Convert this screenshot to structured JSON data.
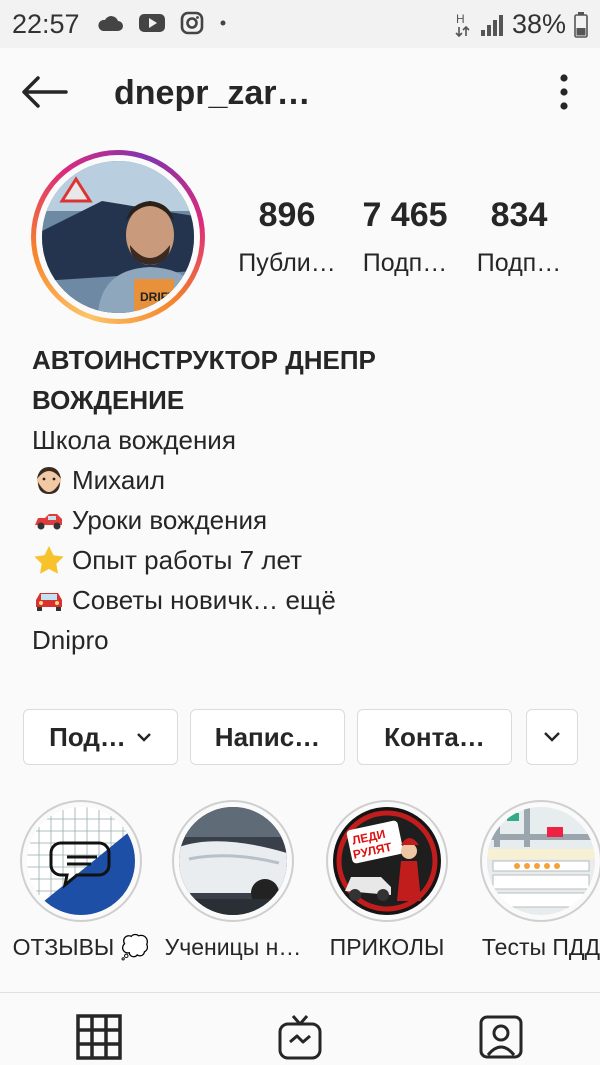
{
  "status_bar": {
    "time": "22:57",
    "battery": "38%",
    "icons": [
      "cloud-icon",
      "youtube-icon",
      "instagram-icon",
      "dot-icon",
      "data-h-icon",
      "signal-icon",
      "battery-icon"
    ]
  },
  "header": {
    "username": "dnepr_zar…",
    "back_icon": "arrow-left-icon",
    "more_icon": "more-vertical-icon"
  },
  "stats": [
    {
      "value": "896",
      "label": "Публи…"
    },
    {
      "value": "7 465",
      "label": "Подп…"
    },
    {
      "value": "834",
      "label": "Подп…"
    }
  ],
  "bio": {
    "name_line1": "АВТОИНСТРУКТОР ДНЕПР",
    "name_line2": "ВОЖДЕНИЕ",
    "category": "Школа вождения",
    "lines": [
      {
        "emoji": "bearded-man",
        "text": "Михаил"
      },
      {
        "emoji": "red-car",
        "text": "Уроки вождения"
      },
      {
        "emoji": "star",
        "text": "Опыт работы 7 лет"
      },
      {
        "emoji": "red-car-front",
        "text": "Советы новичк… ещё"
      }
    ],
    "location": "Dnipro"
  },
  "buttons": {
    "follow": "Под…",
    "message": "Напис…",
    "contact": "Конта…",
    "dropdown_icon": "chevron-down-icon"
  },
  "highlights": [
    {
      "label": "ОТЗЫВЫ 💭"
    },
    {
      "label": "Ученицы н…"
    },
    {
      "label": "ПРИКОЛЫ",
      "sticker": "ЛЕДИ РУЛЯТ"
    },
    {
      "label": "Тесты ПДД"
    }
  ],
  "bottom_nav": [
    "grid-icon",
    "igtv-icon",
    "tagged-icon"
  ],
  "colors": {
    "background": "#fafafa",
    "text": "#262626",
    "border": "#dbdbdb",
    "story_ring": "#dd2a7b"
  }
}
